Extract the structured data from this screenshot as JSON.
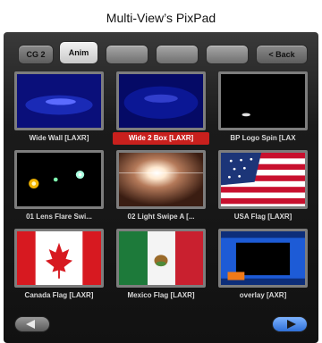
{
  "page_title": "Multi-View’s PixPad",
  "tabs": [
    {
      "label": "CG 2"
    },
    {
      "label": "Anim"
    },
    {
      "label": ""
    },
    {
      "label": ""
    },
    {
      "label": ""
    },
    {
      "label": "< Back"
    }
  ],
  "grid": {
    "items": [
      {
        "label": "Wide Wall [LAXR]"
      },
      {
        "label": "Wide 2 Box [LAXR]"
      },
      {
        "label": "BP Logo Spin [LAX"
      },
      {
        "label": "01 Lens Flare Swi..."
      },
      {
        "label": "02 Light Swipe A [..."
      },
      {
        "label": "USA Flag [LAXR]"
      },
      {
        "label": "Canada Flag [LAXR]"
      },
      {
        "label": "Mexico Flag [LAXR]"
      },
      {
        "label": "overlay [AXR]"
      }
    ]
  },
  "icons": {
    "prev": "left-arrow-icon",
    "next": "right-arrow-icon"
  },
  "colors": {
    "selected_caption": "#c8201d",
    "next_button": "#2f6fd6"
  }
}
